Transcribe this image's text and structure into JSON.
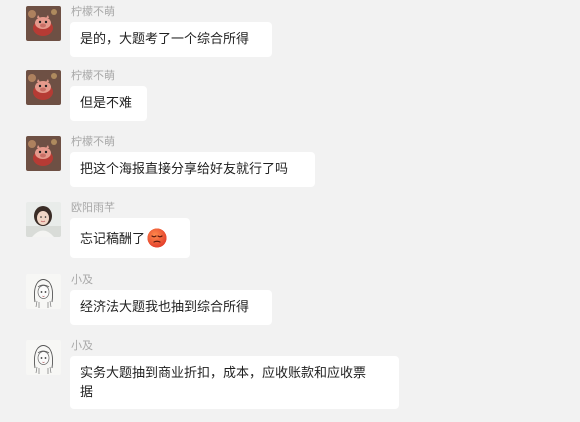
{
  "messages": [
    {
      "sender": "柠檬不萌",
      "text": "是的，大题考了一个综合所得",
      "avatar": "pig-avatar-icon"
    },
    {
      "sender": "柠檬不萌",
      "text": "但是不难",
      "avatar": "pig-avatar-icon"
    },
    {
      "sender": "柠檬不萌",
      "text": "把这个海报直接分享给好友就行了吗",
      "avatar": "pig-avatar-icon"
    },
    {
      "sender": "欧阳雨芊",
      "text": "忘记稿酬了",
      "avatar": "girl-photo-avatar-icon",
      "emoji": "disappointed-face-emoji-icon"
    },
    {
      "sender": "小及",
      "text": "经济法大题我也抽到综合所得",
      "avatar": "sketch-girl-avatar-icon"
    },
    {
      "sender": "小及",
      "text": "实务大题抽到商业折扣，成本，应收账款和应收票",
      "text_line2": "据",
      "avatar": "sketch-girl-avatar-icon"
    }
  ],
  "colors": {
    "background": "#f2f2f2",
    "bubble": "#ffffff",
    "sender_name": "#a8a8a8",
    "text": "#1f1f1f"
  }
}
